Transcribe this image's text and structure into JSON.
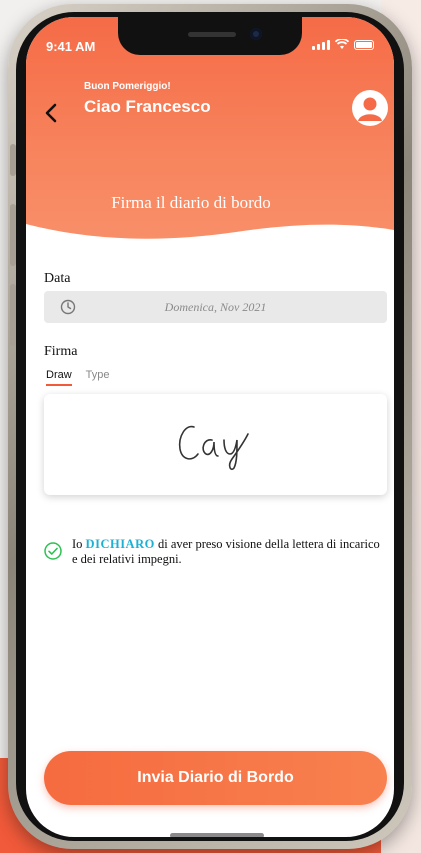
{
  "status_bar": {
    "time": "9:41 AM"
  },
  "header": {
    "greeting_small": "Buon Pomeriggio!",
    "greeting_name": "Ciao Francesco",
    "page_title": "Firma il diario di bordo"
  },
  "form": {
    "date_label": "Data",
    "date_value": "Domenica, Nov 2021",
    "signature_label": "Firma",
    "tabs": [
      {
        "label": "Draw",
        "active": true
      },
      {
        "label": "Type",
        "active": false
      }
    ],
    "declaration": {
      "prefix": "Io",
      "highlight": "DICHIARO",
      "suffix": "di aver preso visione della lettera di incarico e dei relativi impegni.",
      "checked": true
    }
  },
  "submit": {
    "label": "Invia Diario di Bordo"
  },
  "icons": [
    "chevron-left-icon",
    "user-avatar-icon",
    "clock-icon",
    "check-circle-icon",
    "signal-icon",
    "wifi-icon",
    "battery-icon"
  ],
  "colors": {
    "accent": "#f15a3a",
    "header": "#f7845d",
    "highlight": "#1bb0d4",
    "check": "#2cc152"
  }
}
